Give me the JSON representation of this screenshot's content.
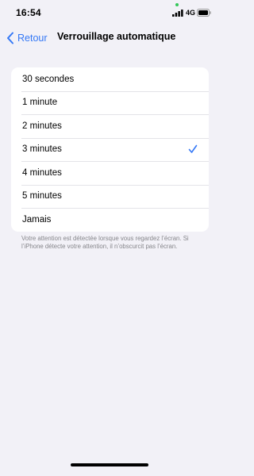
{
  "status_bar": {
    "time": "16:54",
    "network": "4G",
    "signal_icon": "cellular-signal-icon",
    "battery_icon": "battery-icon",
    "camera_indicator_color": "#34c759"
  },
  "nav": {
    "back_label": "Retour",
    "back_icon": "chevron-left-icon",
    "title": "Verrouillage automatique"
  },
  "options": [
    {
      "label": "30 secondes",
      "selected": false
    },
    {
      "label": "1 minute",
      "selected": false
    },
    {
      "label": "2 minutes",
      "selected": false
    },
    {
      "label": "3 minutes",
      "selected": true
    },
    {
      "label": "4 minutes",
      "selected": false
    },
    {
      "label": "5 minutes",
      "selected": false
    },
    {
      "label": "Jamais",
      "selected": false
    }
  ],
  "footer_note": "Votre attention est détectée lorsque vous regardez l’écran. Si l’iPhone détecte votre attention, il n’obscurcit pas l’écran.",
  "colors": {
    "accent": "#3478f6",
    "background": "#f2f1f7",
    "card": "#ffffff",
    "footer_text": "#86868b"
  }
}
